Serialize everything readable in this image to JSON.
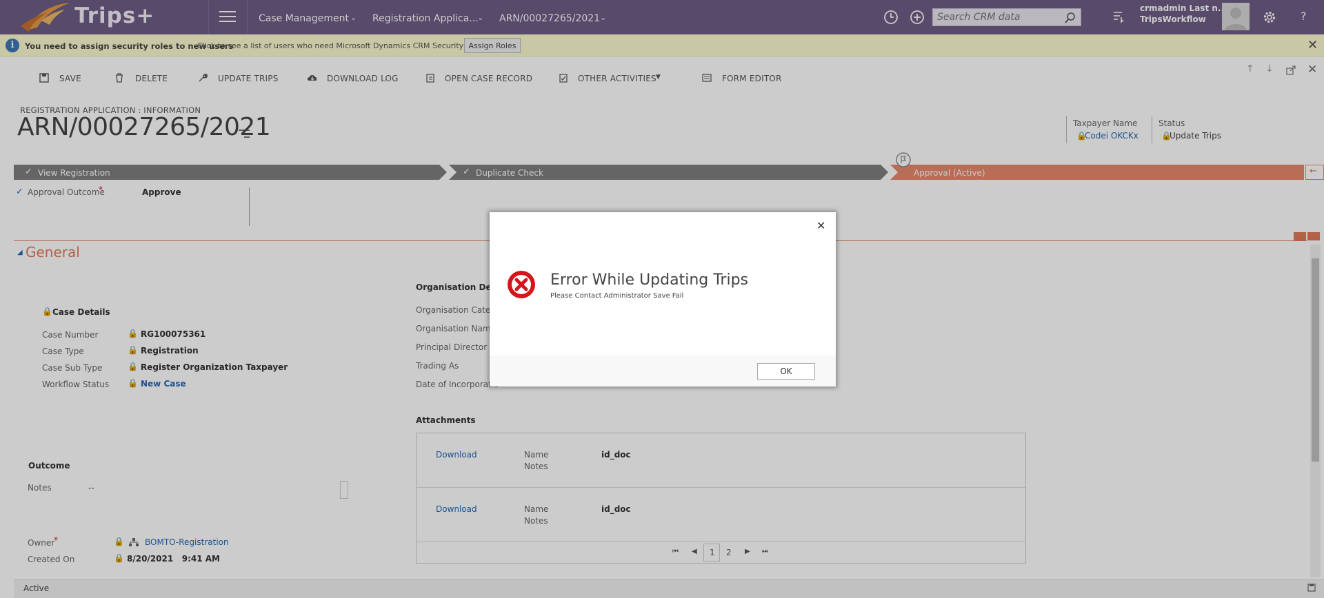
{
  "app": {
    "name": "Trips+"
  },
  "nav": {
    "items": [
      "Case Management",
      "Registration Applica...",
      "ARN/00027265/2021"
    ],
    "search_placeholder": "Search CRM data",
    "user_name": "crmadmin Last n...",
    "user_org": "TripsWorkflow",
    "help": "?"
  },
  "notification": {
    "message": "You need to assign security roles to new users",
    "detail": "Click to see a list of users who need Microsoft Dynamics CRM Security Roles.",
    "button": "Assign Roles"
  },
  "commands": [
    "SAVE",
    "DELETE",
    "UPDATE TRIPS",
    "DOWNLOAD LOG",
    "OPEN CASE RECORD",
    "OTHER ACTIVITIES",
    "FORM EDITOR"
  ],
  "header": {
    "entity": "REGISTRATION APPLICATION : INFORMATION",
    "title": "ARN/00027265/2021",
    "taxpayer_label": "Taxpayer Name",
    "taxpayer_value": "Codei OKCKx",
    "status_label": "Status",
    "status_value": "Update Trips"
  },
  "process": {
    "stages": [
      "View Registration",
      "Duplicate Check",
      "Approval (Active)"
    ],
    "field_label": "Approval Outcome",
    "field_value": "Approve"
  },
  "section": {
    "title": "General"
  },
  "case_details": {
    "heading": "Case Details",
    "fields": [
      {
        "label": "Case Number",
        "value": "RG100075361"
      },
      {
        "label": "Case Type",
        "value": "Registration"
      },
      {
        "label": "Case Sub Type",
        "value": "Register Organization Taxpayer"
      },
      {
        "label": "Workflow Status",
        "value": "New Case"
      }
    ]
  },
  "organisation": {
    "heading": "Organisation Detai",
    "labels": [
      "Organisation Catego",
      "Organisation Name",
      "Principal Director Na",
      "Trading As",
      "Date of Incorporatio"
    ]
  },
  "outcome": {
    "heading": "Outcome",
    "notes_label": "Notes",
    "notes_value": "--",
    "owner_label": "Owner",
    "owner_value": "BOMTO-Registration",
    "created_label": "Created On",
    "created_value": "8/20/2021   9:41 AM"
  },
  "attachments": {
    "heading": "Attachments",
    "rows": [
      {
        "link": "Download",
        "name_label": "Name",
        "notes_label": "Notes",
        "name_value": "id_doc"
      },
      {
        "link": "Download",
        "name_label": "Name",
        "notes_label": "Notes",
        "name_value": "id_doc"
      }
    ],
    "pages": [
      "1",
      "2"
    ]
  },
  "footer": {
    "status": "Active"
  },
  "dialog": {
    "title": "Error While Updating Trips",
    "message": "Please Contact Administrator Save Fail",
    "ok": "OK"
  },
  "colors": {
    "nav_bg": "#6d5d85",
    "accent": "#e07b5a",
    "stage_done": "#7f7f7f",
    "stage_active": "#e8876c",
    "error_red": "#d7141a",
    "link": "#2566b2"
  }
}
